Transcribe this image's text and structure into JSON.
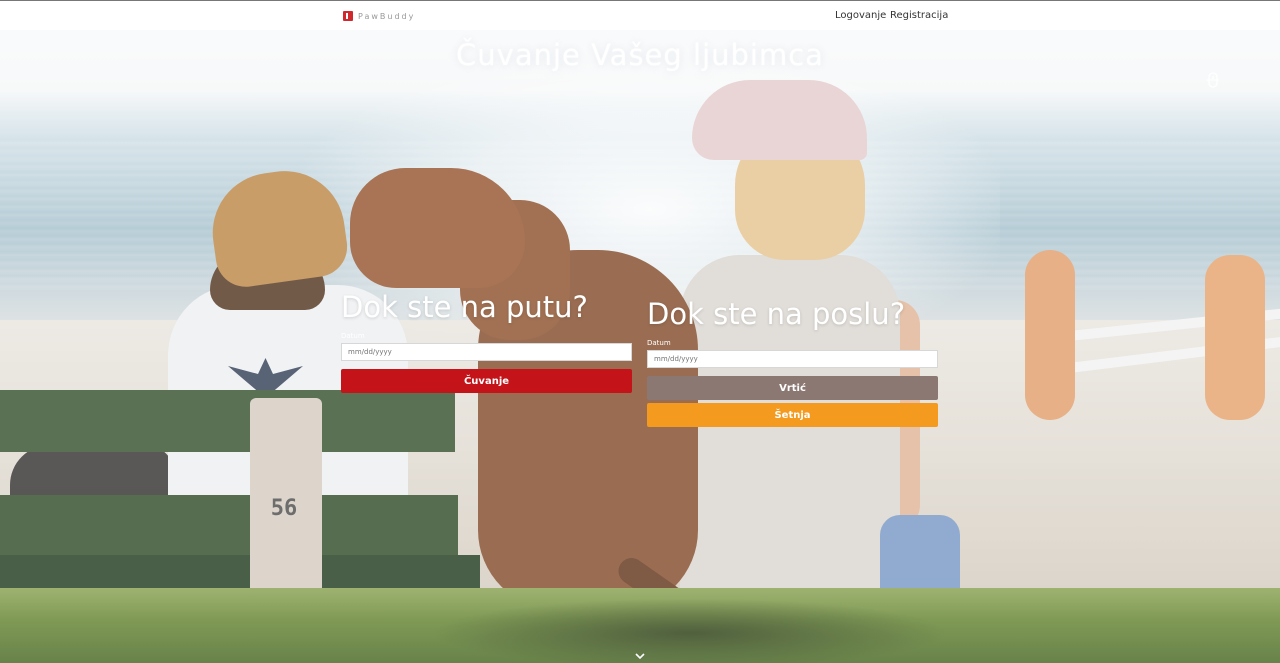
{
  "brand": {
    "name": "PawBuddy",
    "accent": "#d0282d"
  },
  "nav": {
    "login": "Logovanje",
    "register": "Registracija"
  },
  "hero": {
    "title": "Čuvanje Vašeg ljubimca"
  },
  "bench_number": "56",
  "travel_card": {
    "title": "Dok ste na putu?",
    "date_label": "Datum",
    "date_placeholder": "mm/dd/yyyy",
    "button_label": "Čuvanje",
    "button_color": "#c4141a"
  },
  "work_card": {
    "title": "Dok ste na poslu?",
    "date_label": "Datum",
    "date_placeholder": "mm/dd/yyyy",
    "daycare_label": "Vrtić",
    "daycare_color": "#8c7873",
    "walk_label": "Šetnja",
    "walk_color": "#f39a1f"
  },
  "icons": {
    "side": "mouse-scroll-icon",
    "bottom": "chevron-down-icon"
  }
}
